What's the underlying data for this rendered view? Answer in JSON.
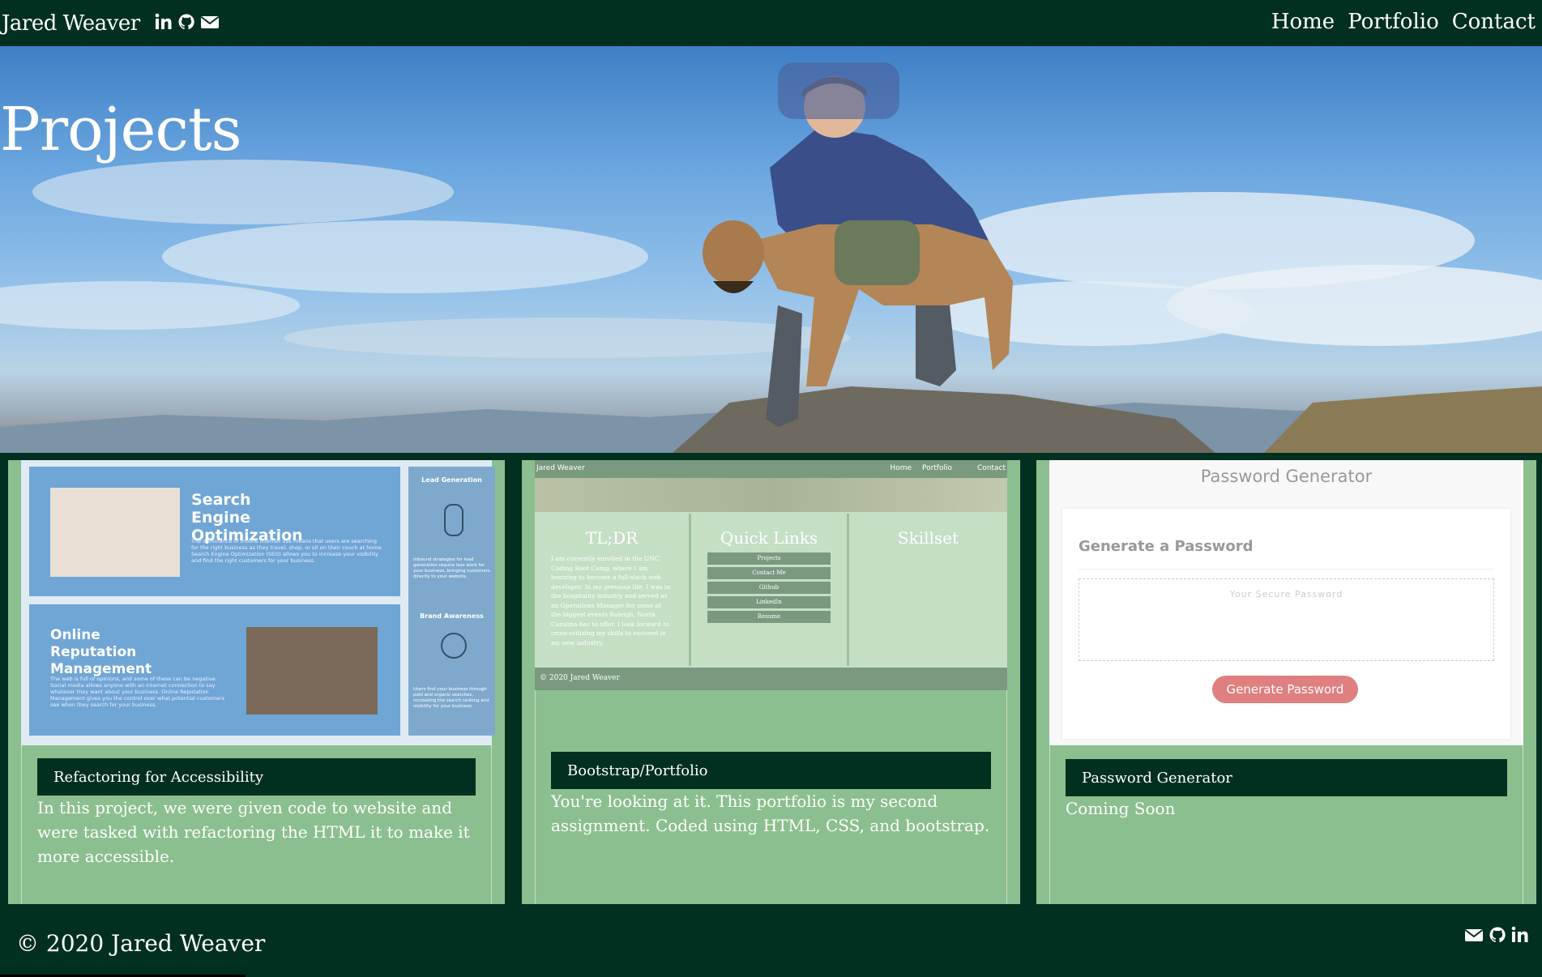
{
  "nav": {
    "brand": "Jared Weaver",
    "links": [
      "Home",
      "Portfolio",
      "Contact"
    ],
    "icons": [
      "linkedin-icon",
      "github-icon",
      "envelope-icon"
    ]
  },
  "hero": {
    "title": "Projects"
  },
  "cards": [
    {
      "title": "Refactoring for Accessibility",
      "description": "In this project, we were given code to website and were tasked with refactoring the HTML it to make it more accessible.",
      "preview": {
        "seo_title": "Search Engine Optimization",
        "seo_body": "The dominance of mobile internet use means that users are searching for the right business as they travel, shop, or sit on their couch at home. Search Engine Optimization (SEO) allows you to increase your visibility and find the right customers for your business.",
        "orm_title": "Online Reputation Management",
        "orm_body": "The web is full of opinions, and some of these can be negative. Social media allows anyone with an internet connection to say whatever they want about your business. Online Reputation Management gives you the control over what potential customers see when they search for your business.",
        "lead_title": "Lead Generation",
        "lead_body": "Inbound strategies for lead generation require less work for your business, bringing customers directly to your website.",
        "brand_title": "Brand Awareness",
        "brand_body": "Users find your business through paid and organic searches, increasing the search ranking and visibility for your business."
      }
    },
    {
      "title": "Bootstrap/Portfolio",
      "description": "You're looking at it. This portfolio is my second assignment. Coded using HTML, CSS, and bootstrap.",
      "preview": {
        "brand": "Jared Weaver",
        "links": [
          "Home",
          "Portfolio",
          "Contact"
        ],
        "tldr_title": "TL;DR",
        "tldr_body": "I am currently enrolled in the UNC Coding Boot Camp, where I am learning to become a full-stack web developer. In my previous life, I was in the hospitality industry and served as an Operations Manager for some of the biggest events Raleigh, North Carolina has to offer. I look forward to cross-utilizing my skills to succeed in my new industry.",
        "quick_title": "Quick Links",
        "quick_links": [
          "Projects",
          "Contact Me",
          "Github",
          "LinkedIn",
          "Resume"
        ],
        "skill_title": "Skillset",
        "footer": "© 2020 Jared Weaver"
      }
    },
    {
      "title": "Password Generator",
      "description": "Coming Soon",
      "preview": {
        "heading": "Password Generator",
        "sub": "Generate a Password",
        "placeholder": "Your Secure Password",
        "button": "Generate Password"
      }
    }
  ],
  "footer": {
    "copyright": "© 2020 Jared Weaver",
    "icons": [
      "envelope-icon",
      "github-icon",
      "linkedin-icon"
    ]
  }
}
